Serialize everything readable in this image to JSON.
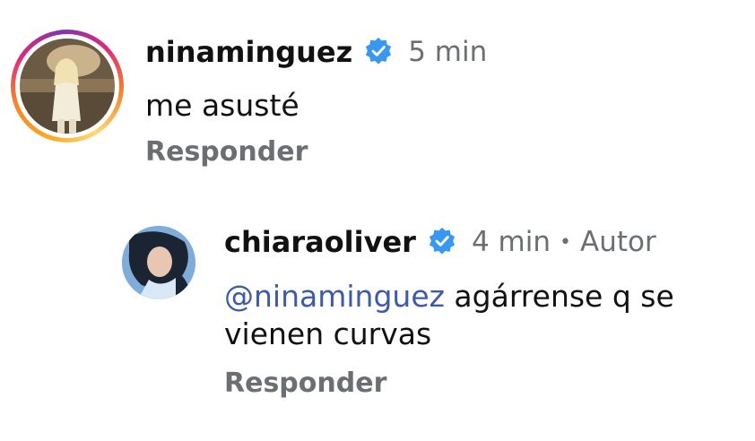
{
  "comments": [
    {
      "username": "ninaminguez",
      "verified": true,
      "time": "5 min",
      "text": "me asusté",
      "reply_label": "Responder",
      "avatar_has_story_ring": true
    },
    {
      "username": "chiaraoliver",
      "verified": true,
      "time": "4 min",
      "author_badge": "Autor",
      "mention": "@ninaminguez",
      "text_after_mention": " agárrense q se vienen curvas",
      "reply_label": "Responder"
    }
  ],
  "colors": {
    "verified_badge": "#3897f0",
    "mention": "#3e5aa8",
    "secondary_text": "#6b6f74"
  },
  "icons": {
    "verified": "verified-badge-icon",
    "avatar": "avatar"
  }
}
